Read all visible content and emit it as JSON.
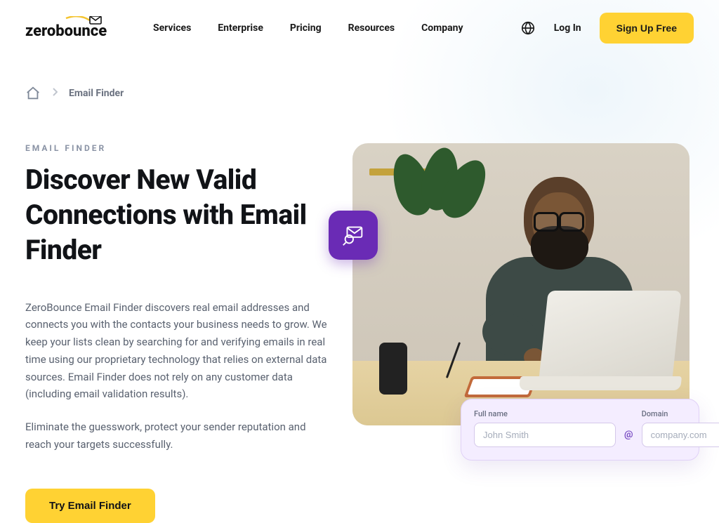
{
  "brand": {
    "name_part1": "zero",
    "name_part2": "bounce"
  },
  "nav": {
    "items": [
      "Services",
      "Enterprise",
      "Pricing",
      "Resources",
      "Company"
    ],
    "login": "Log In",
    "signup": "Sign Up Free"
  },
  "breadcrumb": {
    "current": "Email Finder"
  },
  "hero": {
    "eyebrow": "EMAIL FINDER",
    "title": "Discover New Valid Connections with Email Finder",
    "body1": "ZeroBounce Email Finder discovers real email addresses and connects you with the contacts your business needs to grow. We keep your lists clean by searching for and verifying emails in real time using our proprietary technology that relies on external data sources. Email Finder does not rely on any customer data (including email validation results).",
    "body2": "Eliminate the guesswork, protect your sender reputation and reach your targets successfully.",
    "cta": "Try Email Finder"
  },
  "finder_card": {
    "fullname_label": "Full name",
    "fullname_placeholder": "John Smith",
    "domain_label": "Domain",
    "domain_placeholder": "company.com",
    "separator": "@"
  },
  "colors": {
    "accent_yellow": "#ffd233",
    "accent_purple": "#6a2bb5"
  }
}
